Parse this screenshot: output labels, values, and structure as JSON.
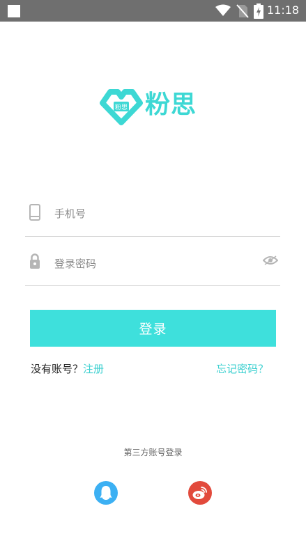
{
  "status_bar": {
    "time": "11:18",
    "icons": [
      "notification-square-icon",
      "wifi-icon",
      "no-sim-icon",
      "battery-charging-icon"
    ]
  },
  "logo": {
    "text": "粉思",
    "badge_text": "粉思",
    "color": "#3dd8d4"
  },
  "login_form": {
    "phone_placeholder": "手机号",
    "phone_value": "",
    "password_placeholder": "登录密码",
    "password_value": "",
    "submit_label": "登录",
    "no_account_text": "没有账号？",
    "register_label": "注册",
    "forgot_password_label": "忘记密码？"
  },
  "third_party": {
    "label": "第三方账号登录",
    "providers": [
      {
        "name": "QQ",
        "icon": "qq-icon",
        "color": "#3cb0f3"
      },
      {
        "name": "Weibo",
        "icon": "weibo-icon",
        "color": "#e24a3c"
      }
    ]
  },
  "colors": {
    "accent": "#3ee0dc",
    "link": "#3dd0d0",
    "status_bar": "#6f6f6f"
  }
}
